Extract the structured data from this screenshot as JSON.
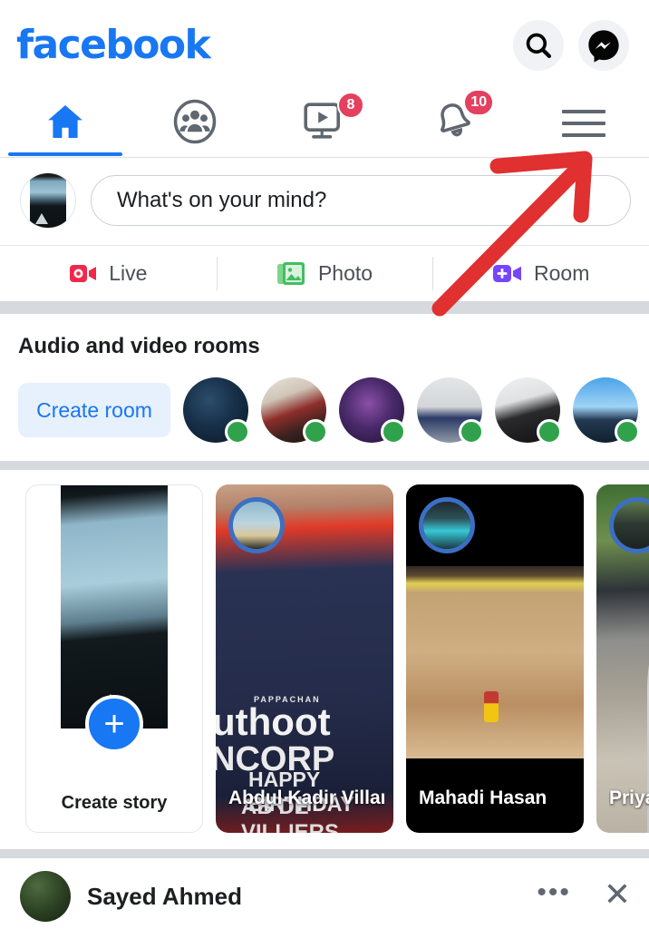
{
  "app": {
    "logo_text": "facebook",
    "brand_color": "#1877f2"
  },
  "header": {
    "search_icon": "search-icon",
    "messenger_icon": "messenger-icon"
  },
  "tabs": [
    {
      "name": "home",
      "icon": "home-icon",
      "active": true,
      "badge": ""
    },
    {
      "name": "friends",
      "icon": "friends-icon",
      "active": false,
      "badge": ""
    },
    {
      "name": "watch",
      "icon": "watch-video-icon",
      "active": false,
      "badge": "8"
    },
    {
      "name": "notifications",
      "icon": "bell-icon",
      "active": false,
      "badge": "10"
    },
    {
      "name": "menu",
      "icon": "hamburger-menu-icon",
      "active": false,
      "badge": ""
    }
  ],
  "composer": {
    "placeholder": "What's on your mind?",
    "avatar": "user-avatar"
  },
  "composer_actions": [
    {
      "label": "Live",
      "icon": "live-video-icon",
      "color": "#f02849"
    },
    {
      "label": "Photo",
      "icon": "photo-icon",
      "color": "#45bd62"
    },
    {
      "label": "Room",
      "icon": "video-room-icon",
      "color": "#7646ff"
    }
  ],
  "rooms": {
    "title": "Audio and video rooms",
    "create_label": "Create room",
    "avatars": [
      {
        "name": "room-avatar-1",
        "online": true
      },
      {
        "name": "room-avatar-2",
        "online": true
      },
      {
        "name": "room-avatar-3",
        "online": true
      },
      {
        "name": "room-avatar-4",
        "online": true
      },
      {
        "name": "room-avatar-5",
        "online": true
      },
      {
        "name": "room-avatar-6",
        "online": true
      },
      {
        "name": "room-avatar-7",
        "online": false
      }
    ]
  },
  "stories": {
    "create_label": "Create story",
    "items": [
      {
        "name": "Abdul Kadir Villani",
        "overlay_line1": "uthoot",
        "overlay_line2": "NCORP",
        "overlay_line3": "HAPPY BIRTHDAY",
        "overlay_line4": "AB DE VILLIERS",
        "overlay_small": "PAPPACHAN"
      },
      {
        "name": "Mahadi Hasan",
        "overlay_line1": "",
        "overlay_line2": "",
        "overlay_line3": "",
        "overlay_line4": "",
        "overlay_small": ""
      },
      {
        "name": "Priyan",
        "overlay_line1": "",
        "overlay_line2": "",
        "overlay_line3": "",
        "overlay_line4": "",
        "overlay_small": ""
      }
    ]
  },
  "feed_post": {
    "author": "Sayed Ahmed",
    "more_label": "•••",
    "close_label": "✕"
  },
  "annotation": {
    "type": "arrow",
    "color": "#e03030",
    "points_to": "hamburger-menu-icon"
  }
}
